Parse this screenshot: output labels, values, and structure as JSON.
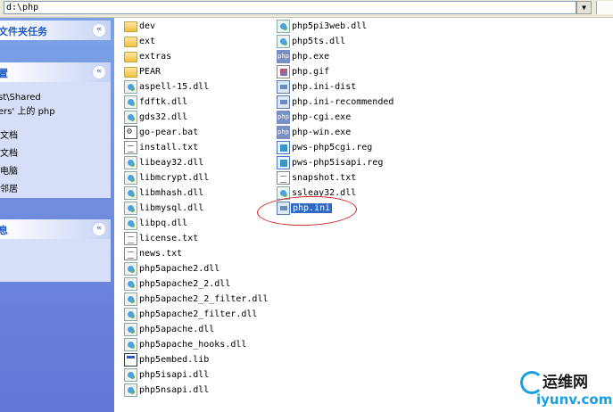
{
  "address_bar": {
    "path": "d:\\php",
    "dropdown_glyph": "▼"
  },
  "task_pane": {
    "panels": [
      {
        "title": "文件夹任务",
        "chevron": "«",
        "items": []
      },
      {
        "title": "置",
        "chevron": "«",
        "items": [
          "st\\Shared",
          "ers' 上的 php",
          "文档",
          "文档",
          "电脑",
          "邻居"
        ]
      },
      {
        "title": "息",
        "chevron": "«",
        "items": [
          "",
          ""
        ]
      }
    ]
  },
  "files": {
    "column1": [
      {
        "name": "dev",
        "type": "folder"
      },
      {
        "name": "ext",
        "type": "folder"
      },
      {
        "name": "extras",
        "type": "folder"
      },
      {
        "name": "PEAR",
        "type": "folder"
      },
      {
        "name": "aspell-15.dll",
        "type": "dll"
      },
      {
        "name": "fdftk.dll",
        "type": "dll"
      },
      {
        "name": "gds32.dll",
        "type": "dll"
      },
      {
        "name": "go-pear.bat",
        "type": "bat"
      },
      {
        "name": "install.txt",
        "type": "txt"
      },
      {
        "name": "libeay32.dll",
        "type": "dll"
      },
      {
        "name": "libmcrypt.dll",
        "type": "dll"
      },
      {
        "name": "libmhash.dll",
        "type": "dll"
      },
      {
        "name": "libmysql.dll",
        "type": "dll"
      },
      {
        "name": "libpq.dll",
        "type": "dll"
      },
      {
        "name": "license.txt",
        "type": "txt"
      },
      {
        "name": "news.txt",
        "type": "txt"
      },
      {
        "name": "php5apache2.dll",
        "type": "dll"
      },
      {
        "name": "php5apache2_2.dll",
        "type": "dll"
      },
      {
        "name": "php5apache2_2_filter.dll",
        "type": "dll"
      },
      {
        "name": "php5apache2_filter.dll",
        "type": "dll"
      },
      {
        "name": "php5apache.dll",
        "type": "dll"
      },
      {
        "name": "php5apache_hooks.dll",
        "type": "dll"
      },
      {
        "name": "php5embed.lib",
        "type": "lib"
      },
      {
        "name": "php5isapi.dll",
        "type": "dll"
      },
      {
        "name": "php5nsapi.dll",
        "type": "dll"
      }
    ],
    "column2": [
      {
        "name": "php5pi3web.dll",
        "type": "dll"
      },
      {
        "name": "php5ts.dll",
        "type": "dll"
      },
      {
        "name": "php.exe",
        "type": "exe"
      },
      {
        "name": "php.gif",
        "type": "gif"
      },
      {
        "name": "php.ini-dist",
        "type": "ini"
      },
      {
        "name": "php.ini-recommended",
        "type": "ini"
      },
      {
        "name": "php-cgi.exe",
        "type": "exe"
      },
      {
        "name": "php-win.exe",
        "type": "exe"
      },
      {
        "name": "pws-php5cgi.reg",
        "type": "reg"
      },
      {
        "name": "pws-php5isapi.reg",
        "type": "reg"
      },
      {
        "name": "snapshot.txt",
        "type": "txt"
      },
      {
        "name": "ssleay32.dll",
        "type": "dll"
      },
      {
        "name": "php.ini",
        "type": "ini",
        "selected": true
      }
    ]
  },
  "icons": {
    "exe_label": "php"
  },
  "watermark": {
    "text_cn": "运维网",
    "url": "iyunv.com"
  },
  "colors": {
    "selection": "#316ac5",
    "annotation_ellipse": "#d22020",
    "task_pane_blue": "#7ba2e7",
    "watermark_blue": "#1aa0e0"
  }
}
